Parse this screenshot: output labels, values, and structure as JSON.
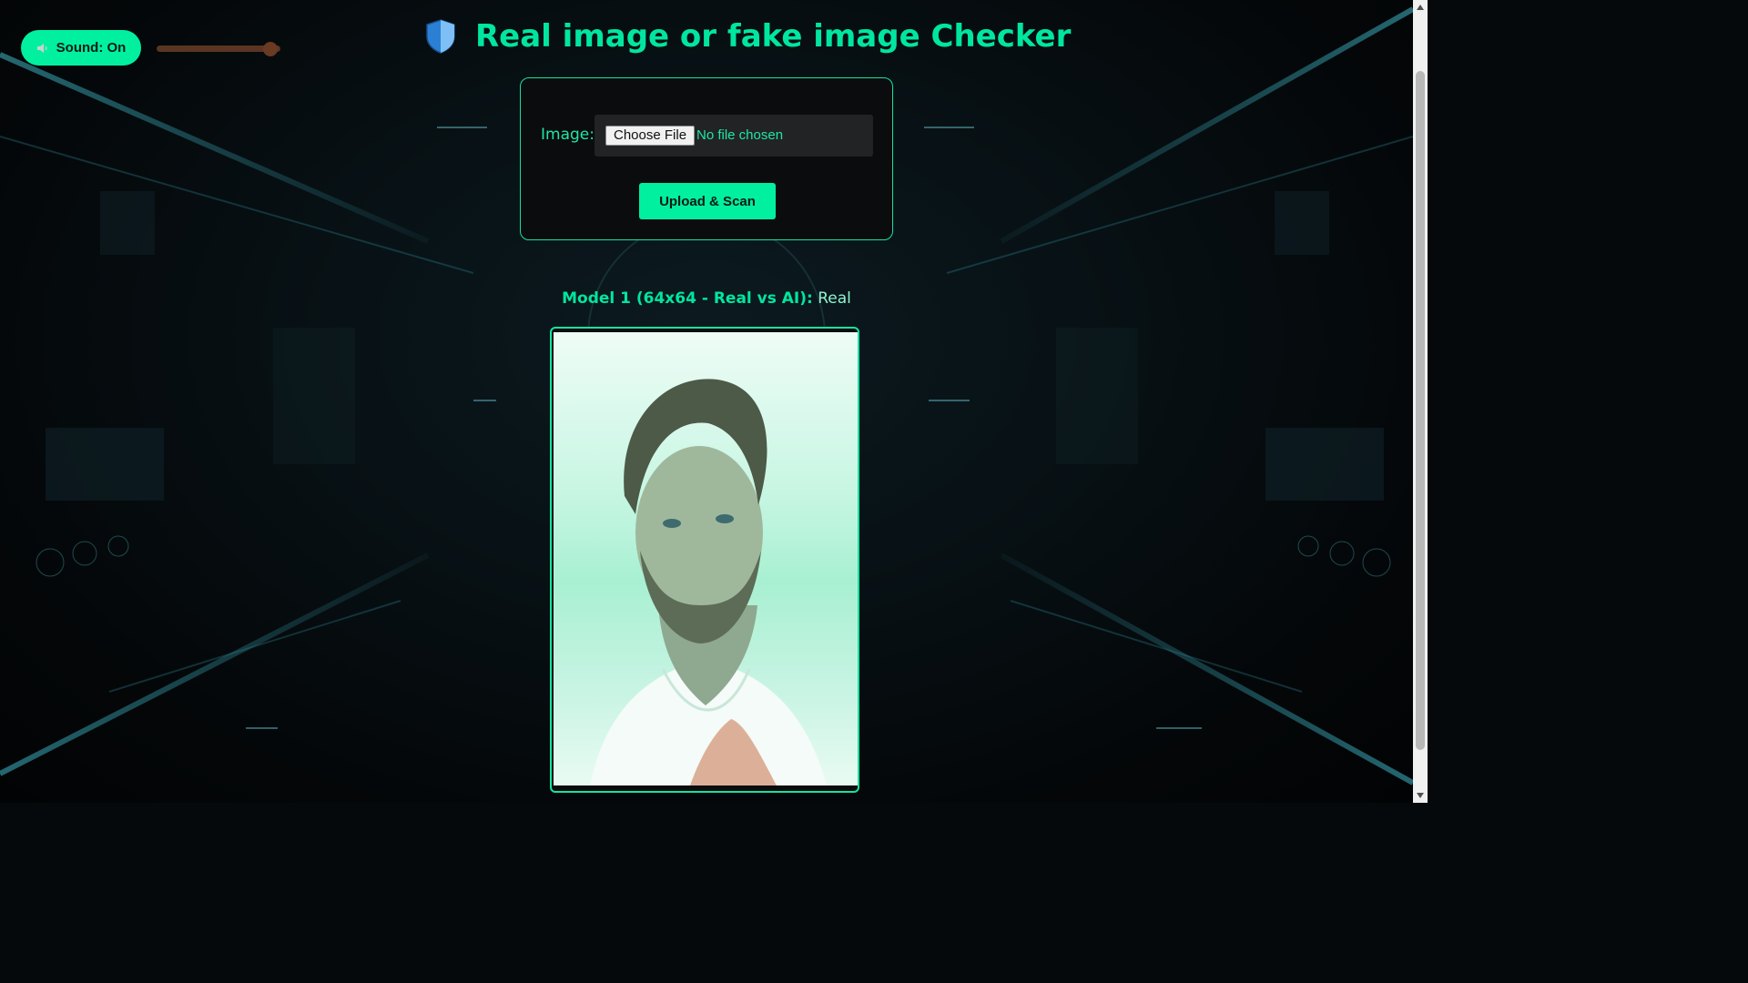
{
  "header": {
    "title": "Real image or fake image Checker",
    "logo_icon": "shield-icon"
  },
  "sound": {
    "button_label": "Sound: On",
    "icon": "speaker-icon",
    "volume": 0.9
  },
  "upload": {
    "image_label": "Image:",
    "choose_file_label": "Choose File",
    "file_status": "No file chosen",
    "scan_button_label": "Upload & Scan"
  },
  "result": {
    "label": "Model 1 (64x64 - Real vs AI):",
    "value": "Real"
  },
  "colors": {
    "accent": "#00f0a0",
    "title": "#00e6a0",
    "background": "#05090c",
    "slider": "#6b3a22"
  }
}
